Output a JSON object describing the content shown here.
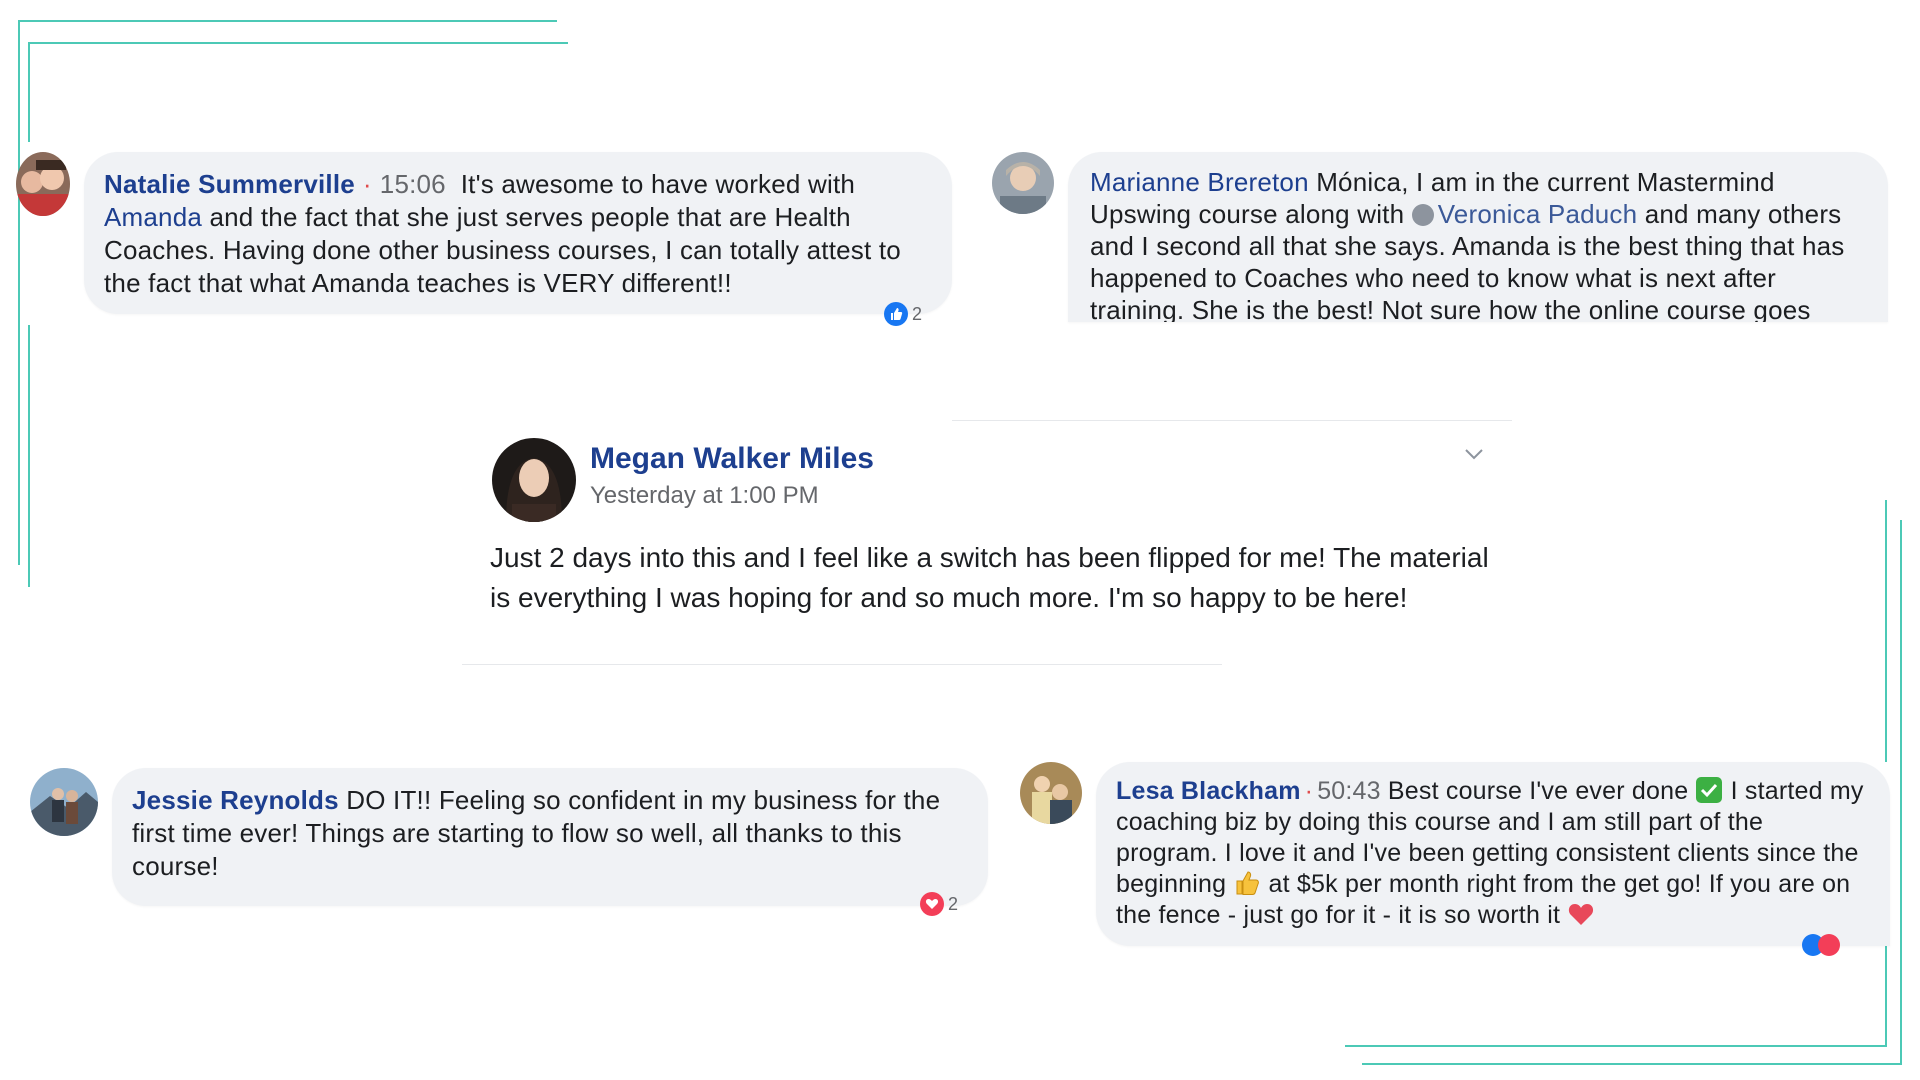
{
  "colors": {
    "frame_accent": "#4cc9b6",
    "bubble_bg": "#f0f2f5",
    "name_link": "#1d3f8f",
    "like_blue": "#1877f2",
    "love_red": "#f33e58"
  },
  "comments": [
    {
      "name": "Natalie Summerville",
      "time": "15:06",
      "text_before_mention": "It's awesome to have worked with ",
      "mention": "Amanda",
      "text_after_mention": " and the fact that she just serves people that are Health Coaches. Having done other business courses, I can totally attest to the fact that what Amanda teaches is VERY different!!",
      "reaction_icon": "like-icon",
      "reaction_count": "2"
    },
    {
      "name": "Marianne Brereton",
      "text_before_mention": "Mónica, I am in the current Mastermind Upswing course along with ",
      "mention": "Veronica Paduch",
      "text_after_mention": " and many others and I second all that she says. Amanda is the best thing that has happened to Coaches who need to know what is next after training. She is the best! Not sure how the online course goes"
    },
    {
      "name": "Jessie Reynolds",
      "text": "DO IT!! Feeling so confident in my business for the first time ever! Things are starting to flow so well, all thanks to this course!",
      "reaction_icon": "heart-icon",
      "reaction_count": "2"
    },
    {
      "name": "Lesa Blackham",
      "time": "50:43",
      "text_part1": "Best course I've ever done",
      "text_part2": " I started my coaching biz by doing this course and I am still part of the program. I love it and I've been getting consistent clients since the beginning ",
      "text_part3": " at $5k per month right from the get go! If you are on the fence - just go for it - it is so worth it "
    }
  ],
  "post": {
    "author": "Megan Walker Miles",
    "timestamp": "Yesterday at 1:00 PM",
    "text": "Just 2 days into this and I feel like a switch has been flipped for me! The material is everything I was hoping for and so much more. I'm so happy to be here!",
    "menu_icon": "chevron-down-icon"
  }
}
